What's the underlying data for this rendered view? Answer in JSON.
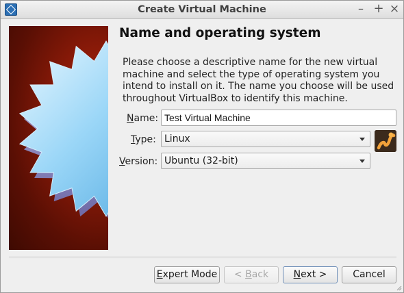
{
  "window": {
    "title": "Create Virtual Machine",
    "controls": {
      "minimize": "–",
      "maximize": "+",
      "close": "×"
    }
  },
  "page": {
    "heading": "Name and operating system",
    "description": "Please choose a descriptive name for the new virtual machine and select the type of operating system you intend to install on it. The name you choose will be used throughout VirtualBox to identify this machine."
  },
  "form": {
    "name": {
      "label_mnemonic": "N",
      "label_rest": "ame:",
      "value": "Test Virtual Machine"
    },
    "type": {
      "label_mnemonic": "T",
      "label_rest": "ype:",
      "selected": "Linux",
      "icon": "linux-os-icon"
    },
    "version": {
      "label_mnemonic": "V",
      "label_rest": "ersion:",
      "selected": "Ubuntu (32-bit)"
    }
  },
  "buttons": {
    "expert": {
      "mnemonic": "E",
      "rest": "xpert Mode"
    },
    "back": {
      "prefix": "< ",
      "mnemonic": "B",
      "rest": "ack",
      "enabled": false
    },
    "next": {
      "mnemonic": "N",
      "rest": "ext >"
    },
    "cancel": {
      "label": "Cancel"
    }
  },
  "colors": {
    "banner_red": "#8a1a08",
    "star_blue": "#7ec8f0",
    "accent": "#2b6fb4"
  }
}
